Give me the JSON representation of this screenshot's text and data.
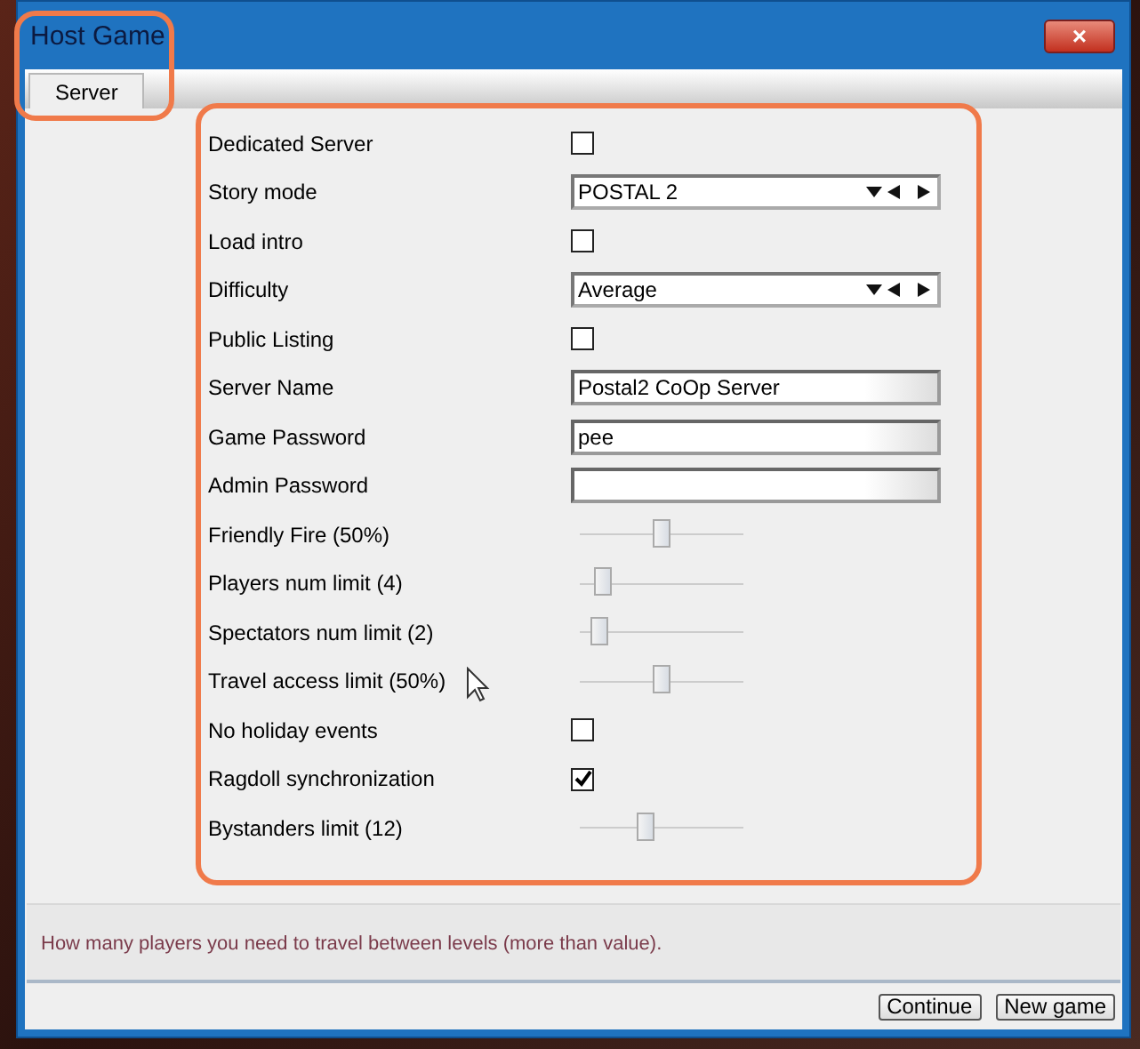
{
  "window": {
    "title": "Host Game",
    "close": "×"
  },
  "tabs": [
    {
      "label": "Server",
      "selected": true
    }
  ],
  "settings": [
    {
      "kind": "checkbox",
      "label": "Dedicated Server",
      "checked": false
    },
    {
      "kind": "select",
      "label": "Story mode",
      "value": "POSTAL 2"
    },
    {
      "kind": "checkbox",
      "label": "Load intro",
      "checked": false
    },
    {
      "kind": "select",
      "label": "Difficulty",
      "value": "Average"
    },
    {
      "kind": "checkbox",
      "label": "Public Listing",
      "checked": false
    },
    {
      "kind": "text",
      "label": "Server Name",
      "value": "Postal2 CoOp Server"
    },
    {
      "kind": "text",
      "label": "Game Password",
      "value": "pee"
    },
    {
      "kind": "text",
      "label": "Admin Password"
    },
    {
      "kind": "slider",
      "label": "Friendly Fire (50%)",
      "level": 0.5
    },
    {
      "kind": "slider",
      "label": "Players num limit (4)",
      "level": 0.14
    },
    {
      "kind": "slider",
      "label": "Spectators num limit (2)",
      "level": 0.12
    },
    {
      "kind": "slider",
      "label": "Travel access limit (50%)",
      "level": 0.5
    },
    {
      "kind": "checkbox",
      "label": "No holiday events",
      "checked": false
    },
    {
      "kind": "checkbox",
      "label": "Ragdoll synchronization",
      "checked": true
    },
    {
      "kind": "slider",
      "label": "Bystanders limit (12)",
      "level": 0.4
    }
  ],
  "hint": "How many players you need to travel between levels (more than value).",
  "buttons": [
    "Continue",
    "New game"
  ]
}
